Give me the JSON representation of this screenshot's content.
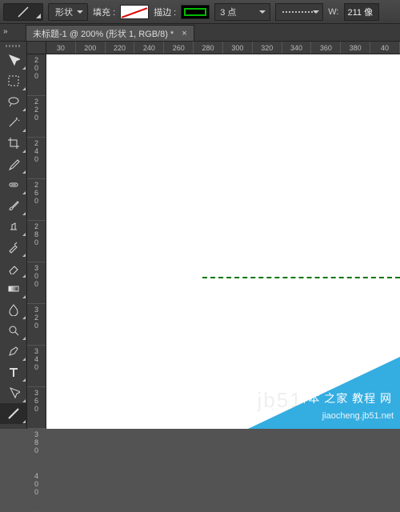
{
  "optionsBar": {
    "modeLabel": "形状",
    "fillLabel": "填充 :",
    "strokeLabel": "描边 :",
    "strokeSize": "3 点",
    "widthLabel": "W:",
    "widthValue": "211 像"
  },
  "tab": {
    "title": "未标题-1 @ 200% (形状 1, RGB/8) *",
    "close": "×"
  },
  "rulerH": [
    "30",
    "200",
    "220",
    "240",
    "260",
    "280",
    "300",
    "320",
    "340",
    "360",
    "380",
    "40"
  ],
  "rulerV": [
    "2\n0\n0",
    "2\n2\n0",
    "2\n4\n0",
    "2\n6\n0",
    "2\n8\n0",
    "3\n0\n0",
    "3\n2\n0",
    "3\n4\n0",
    "3\n6\n0",
    "3\n8\n0",
    "4\n0\n0"
  ],
  "watermark": {
    "line1": "脚本 之家 教程 网",
    "line2": "jiaocheng.jb51.net",
    "bg": "jb51.net"
  },
  "tools": [
    {
      "name": "move-tool"
    },
    {
      "name": "marquee-tool"
    },
    {
      "name": "lasso-tool"
    },
    {
      "name": "magic-wand-tool"
    },
    {
      "name": "crop-tool"
    },
    {
      "name": "eyedropper-tool"
    },
    {
      "name": "healing-brush-tool"
    },
    {
      "name": "brush-tool"
    },
    {
      "name": "clone-stamp-tool"
    },
    {
      "name": "history-brush-tool"
    },
    {
      "name": "eraser-tool"
    },
    {
      "name": "gradient-tool"
    },
    {
      "name": "blur-tool"
    },
    {
      "name": "dodge-tool"
    },
    {
      "name": "pen-tool"
    },
    {
      "name": "type-tool"
    },
    {
      "name": "path-select-tool"
    },
    {
      "name": "line-tool"
    }
  ]
}
